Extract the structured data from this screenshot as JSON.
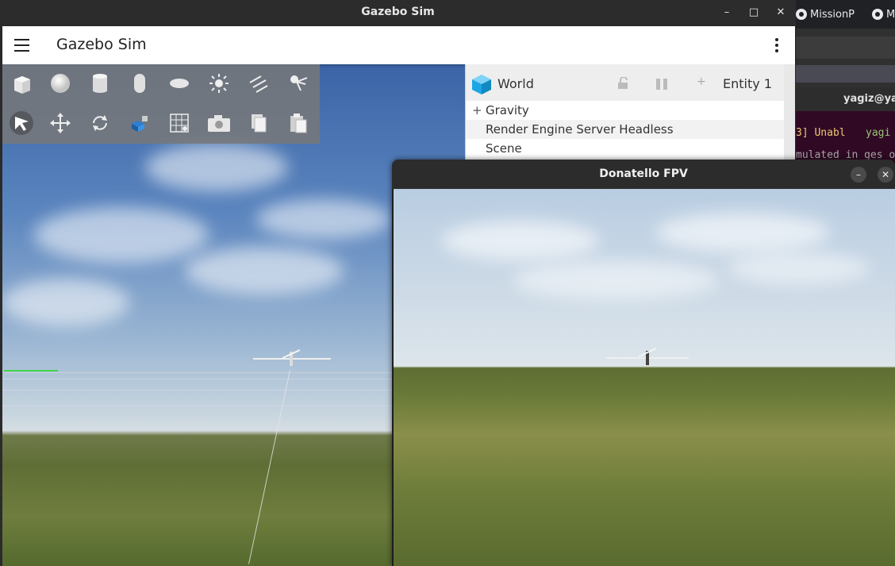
{
  "background": {
    "browser_tabs": [
      "MissionP",
      "M"
    ],
    "terminal_title": "yagiz@ya",
    "terminal_lines": [
      {
        "text": "3] Unabl",
        "color": "#f0c674"
      },
      {
        "text": "yagi",
        "color": "#98c379"
      },
      {
        "text": "mulated in ges o",
        "color": "#aaaaaa"
      }
    ]
  },
  "gazebo": {
    "window_title": "Gazebo Sim",
    "app_title": "Gazebo Sim",
    "window_buttons": {
      "minimize": "–",
      "maximize": "□",
      "close": "✕"
    },
    "toolbar": {
      "row1": [
        "box-icon",
        "sphere-icon",
        "cylinder-icon",
        "capsule-icon",
        "ellipsoid-icon",
        "sun-icon",
        "directional-light-icon",
        "spot-light-icon"
      ],
      "row2": [
        "select-icon",
        "translate-icon",
        "rotate-icon",
        "transform-icon",
        "grid-icon",
        "camera-icon",
        "copy-icon",
        "paste-icon"
      ]
    },
    "entity_tree": {
      "root_label": "World",
      "entity_label": "Entity 1",
      "add_symbol": "+",
      "rows": [
        {
          "label": "Gravity",
          "expander": "+"
        },
        {
          "label": "Render Engine Server Headless",
          "expander": ""
        },
        {
          "label": "Scene",
          "expander": ""
        }
      ]
    }
  },
  "fpv": {
    "window_title": "Donatello FPV",
    "minimize_symbol": "–",
    "close_symbol": "✕"
  },
  "colors": {
    "world_icon": "#1ba6e6",
    "appbar": "#ffffff",
    "titlebar": "#2c2c2c"
  }
}
